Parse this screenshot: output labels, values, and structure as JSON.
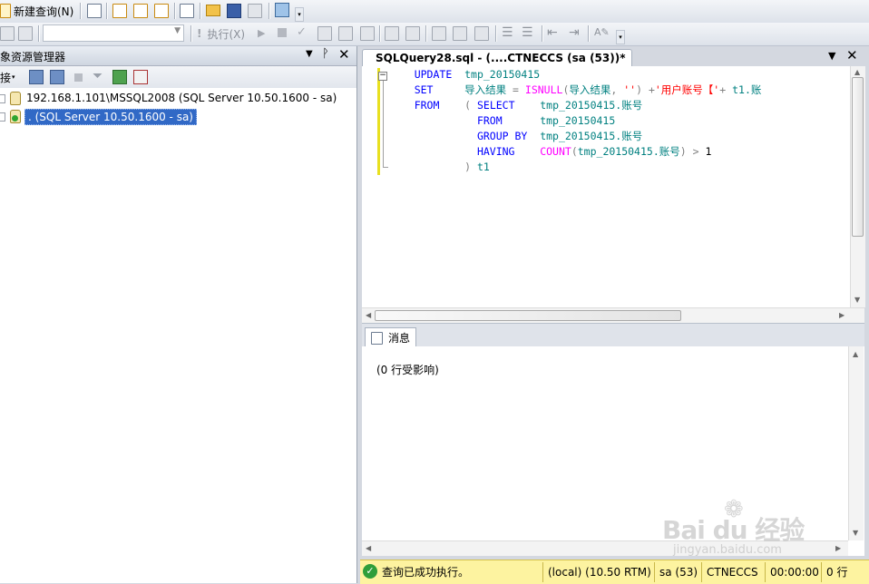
{
  "toolbar1": {
    "new_query_label": "新建查询(N)"
  },
  "toolbar2": {
    "db_select_value": "",
    "execute_label": "执行(X)"
  },
  "object_explorer": {
    "title": "对象资源管理器",
    "connect_label": "连接",
    "servers": [
      {
        "label": "192.168.1.101\\MSSQL2008 (SQL Server 10.50.1600 - sa)",
        "selected": false
      },
      {
        "label": ". (SQL Server 10.50.1600 - sa)",
        "selected": true
      }
    ]
  },
  "editor": {
    "tab_title": "SQLQuery28.sql - (....CTNECCS (sa (53))*",
    "lines": [
      {
        "indent": "    ",
        "tokens": [
          [
            "kw",
            "UPDATE"
          ],
          [
            "plain",
            "  "
          ],
          [
            "id",
            "tmp_20150415"
          ]
        ]
      },
      {
        "indent": "    ",
        "tokens": [
          [
            "kw",
            "SET"
          ],
          [
            "plain",
            "     "
          ],
          [
            "id",
            "导入结果"
          ],
          [
            "op",
            " = "
          ],
          [
            "fn",
            "ISNULL"
          ],
          [
            "op",
            "("
          ],
          [
            "id",
            "导入结果"
          ],
          [
            "op",
            ", "
          ],
          [
            "str",
            "''"
          ],
          [
            "op",
            ") +"
          ],
          [
            "str",
            "'用户账号【'"
          ],
          [
            "op",
            "+ "
          ],
          [
            "id",
            "t1.账"
          ]
        ]
      },
      {
        "indent": "    ",
        "tokens": [
          [
            "kw",
            "FROM"
          ],
          [
            "plain",
            "    "
          ],
          [
            "op",
            "( "
          ],
          [
            "kw",
            "SELECT"
          ],
          [
            "plain",
            "    "
          ],
          [
            "id",
            "tmp_20150415.账号"
          ]
        ]
      },
      {
        "indent": "              ",
        "tokens": [
          [
            "kw",
            "FROM"
          ],
          [
            "plain",
            "      "
          ],
          [
            "id",
            "tmp_20150415"
          ]
        ]
      },
      {
        "indent": "              ",
        "tokens": [
          [
            "kw",
            "GROUP BY"
          ],
          [
            "plain",
            "  "
          ],
          [
            "id",
            "tmp_20150415.账号"
          ]
        ]
      },
      {
        "indent": "              ",
        "tokens": [
          [
            "kw",
            "HAVING"
          ],
          [
            "plain",
            "    "
          ],
          [
            "fn",
            "COUNT"
          ],
          [
            "op",
            "("
          ],
          [
            "id",
            "tmp_20150415.账号"
          ],
          [
            "op",
            ") > "
          ],
          [
            "plain",
            "1"
          ]
        ]
      },
      {
        "indent": "            ",
        "tokens": [
          [
            "op",
            ") "
          ],
          [
            "id",
            "t1"
          ]
        ]
      }
    ]
  },
  "results": {
    "tab_label": "消息",
    "message": "(0 行受影响)"
  },
  "statusbar": {
    "status_text": "查询已成功执行。",
    "server": "(local) (10.50 RTM)",
    "user": "sa (53)",
    "database": "CTNECCS",
    "elapsed": "00:00:00",
    "rows": "0 行"
  },
  "watermark": {
    "brand": "Bai du 经验",
    "url": "jingyan.baidu.com"
  }
}
